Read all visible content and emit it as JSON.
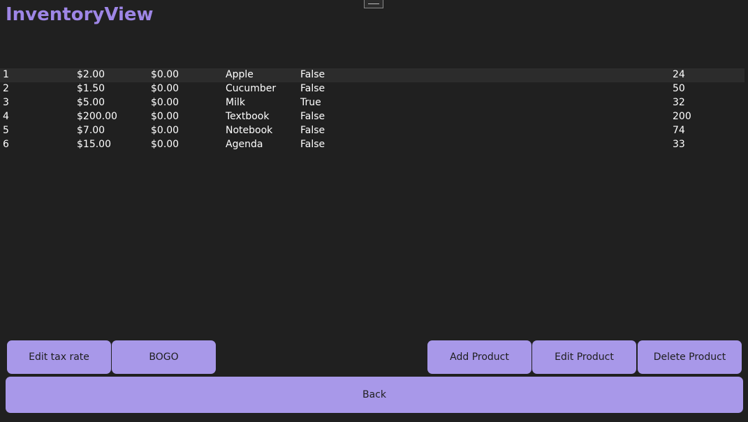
{
  "app": {
    "title": "InventoryView"
  },
  "table": {
    "rows": [
      {
        "id": "1",
        "price": "$2.00",
        "tax": "$0.00",
        "name": "Apple",
        "bogo": "False",
        "quantity": "24",
        "selected": true
      },
      {
        "id": "2",
        "price": "$1.50",
        "tax": "$0.00",
        "name": "Cucumber",
        "bogo": "False",
        "quantity": "50",
        "selected": false
      },
      {
        "id": "3",
        "price": "$5.00",
        "tax": "$0.00",
        "name": "Milk",
        "bogo": "True",
        "quantity": "32",
        "selected": false
      },
      {
        "id": "4",
        "price": "$200.00",
        "tax": "$0.00",
        "name": "Textbook",
        "bogo": "False",
        "quantity": "200",
        "selected": false
      },
      {
        "id": "5",
        "price": "$7.00",
        "tax": "$0.00",
        "name": "Notebook",
        "bogo": "False",
        "quantity": "74",
        "selected": false
      },
      {
        "id": "6",
        "price": "$15.00",
        "tax": "$0.00",
        "name": "Agenda",
        "bogo": "False",
        "quantity": "33",
        "selected": false
      }
    ]
  },
  "buttons": {
    "edit_tax_rate": "Edit tax rate",
    "bogo": "BOGO",
    "add_product": "Add Product",
    "edit_product": "Edit Product",
    "delete_product": "Delete Product",
    "back": "Back"
  },
  "colors": {
    "background": "#202020",
    "title": "#9e86e6",
    "button": "#a898e9",
    "button_text": "#1e1e1e",
    "selected_row": "#2c2c2c"
  }
}
